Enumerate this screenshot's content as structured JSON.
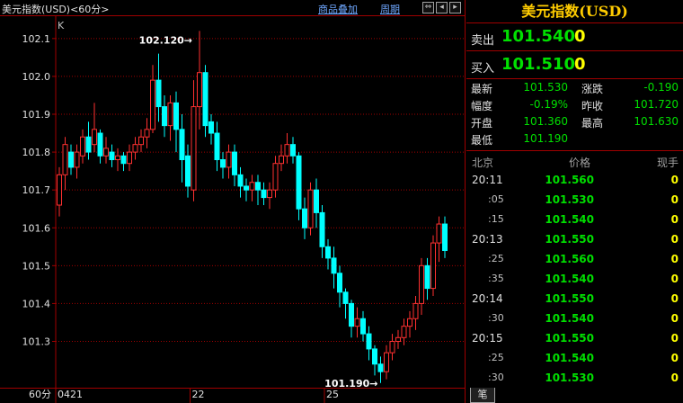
{
  "header": {
    "title": "美元指数(USD)<60分>",
    "overlay_link": "商品叠加",
    "period_link": "周期",
    "icons": [
      "arrows-icon",
      "back-icon",
      "forward-icon",
      "close-icon"
    ]
  },
  "chart_data": {
    "type": "candlestick",
    "corner_label": "K",
    "y_ticks": [
      "102.1",
      "102.0",
      "101.9",
      "101.8",
      "101.7",
      "101.6",
      "101.5",
      "101.4",
      "101.3"
    ],
    "ylim": [
      101.18,
      102.14
    ],
    "x_labels": [
      {
        "index": 0,
        "label": "0421"
      },
      {
        "index": 23,
        "label": "22"
      },
      {
        "index": 46,
        "label": "25"
      }
    ],
    "footer_period": "60分",
    "annotations": {
      "high_label": "102.120",
      "low_label": "101.190"
    },
    "candles": [
      [
        101.66,
        101.74,
        101.63,
        101.76
      ],
      [
        101.74,
        101.82,
        101.7,
        101.84
      ],
      [
        101.8,
        101.76,
        101.74,
        101.82
      ],
      [
        101.76,
        101.8,
        101.73,
        101.82
      ],
      [
        101.79,
        101.84,
        101.77,
        101.86
      ],
      [
        101.84,
        101.8,
        101.78,
        101.88
      ],
      [
        101.82,
        101.86,
        101.8,
        101.93
      ],
      [
        101.85,
        101.79,
        101.77,
        101.86
      ],
      [
        101.79,
        101.81,
        101.77,
        101.84
      ],
      [
        101.8,
        101.78,
        101.76,
        101.82
      ],
      [
        101.78,
        101.79,
        101.75,
        101.81
      ],
      [
        101.79,
        101.77,
        101.75,
        101.8
      ],
      [
        101.77,
        101.8,
        101.75,
        101.82
      ],
      [
        101.8,
        101.82,
        101.78,
        101.84
      ],
      [
        101.82,
        101.84,
        101.8,
        101.86
      ],
      [
        101.84,
        101.86,
        101.81,
        101.89
      ],
      [
        101.86,
        101.99,
        101.85,
        102.03
      ],
      [
        101.99,
        101.92,
        101.88,
        102.06
      ],
      [
        101.92,
        101.87,
        101.84,
        101.95
      ],
      [
        101.87,
        101.93,
        101.83,
        101.95
      ],
      [
        101.93,
        101.86,
        101.8,
        101.96
      ],
      [
        101.86,
        101.78,
        101.72,
        101.9
      ],
      [
        101.79,
        101.71,
        101.68,
        101.82
      ],
      [
        101.7,
        101.92,
        101.67,
        101.99
      ],
      [
        101.92,
        102.01,
        101.86,
        102.12
      ],
      [
        102.01,
        101.87,
        101.84,
        102.03
      ],
      [
        101.88,
        101.85,
        101.82,
        101.9
      ],
      [
        101.85,
        101.78,
        101.75,
        101.88
      ],
      [
        101.78,
        101.76,
        101.73,
        101.8
      ],
      [
        101.76,
        101.8,
        101.73,
        101.82
      ],
      [
        101.8,
        101.74,
        101.71,
        101.82
      ],
      [
        101.74,
        101.71,
        101.68,
        101.76
      ],
      [
        101.71,
        101.7,
        101.67,
        101.73
      ],
      [
        101.7,
        101.72,
        101.67,
        101.74
      ],
      [
        101.72,
        101.7,
        101.66,
        101.74
      ],
      [
        101.7,
        101.68,
        101.66,
        101.72
      ],
      [
        101.68,
        101.7,
        101.65,
        101.72
      ],
      [
        101.7,
        101.77,
        101.68,
        101.79
      ],
      [
        101.77,
        101.79,
        101.75,
        101.82
      ],
      [
        101.79,
        101.82,
        101.77,
        101.85
      ],
      [
        101.82,
        101.79,
        101.77,
        101.84
      ],
      [
        101.79,
        101.65,
        101.62,
        101.8
      ],
      [
        101.65,
        101.6,
        101.57,
        101.68
      ],
      [
        101.6,
        101.7,
        101.58,
        101.72
      ],
      [
        101.7,
        101.64,
        101.6,
        101.73
      ],
      [
        101.64,
        101.55,
        101.52,
        101.66
      ],
      [
        101.55,
        101.52,
        101.49,
        101.57
      ],
      [
        101.52,
        101.48,
        101.44,
        101.55
      ],
      [
        101.48,
        101.43,
        101.39,
        101.5
      ],
      [
        101.43,
        101.4,
        101.36,
        101.44
      ],
      [
        101.4,
        101.34,
        101.31,
        101.41
      ],
      [
        101.34,
        101.36,
        101.31,
        101.39
      ],
      [
        101.36,
        101.32,
        101.3,
        101.38
      ],
      [
        101.32,
        101.28,
        101.25,
        101.34
      ],
      [
        101.28,
        101.24,
        101.21,
        101.29
      ],
      [
        101.24,
        101.22,
        101.19,
        101.26
      ],
      [
        101.22,
        101.27,
        101.2,
        101.29
      ],
      [
        101.27,
        101.3,
        101.25,
        101.32
      ],
      [
        101.3,
        101.31,
        101.28,
        101.33
      ],
      [
        101.31,
        101.34,
        101.29,
        101.36
      ],
      [
        101.34,
        101.36,
        101.31,
        101.38
      ],
      [
        101.36,
        101.4,
        101.33,
        101.42
      ],
      [
        101.4,
        101.5,
        101.37,
        101.52
      ],
      [
        101.5,
        101.44,
        101.41,
        101.52
      ],
      [
        101.44,
        101.56,
        101.42,
        101.58
      ],
      [
        101.56,
        101.61,
        101.51,
        101.63
      ],
      [
        101.61,
        101.54,
        101.52,
        101.63
      ]
    ]
  },
  "quote": {
    "title": "美元指数(USD)",
    "sell": {
      "label": "卖出",
      "price": "101.540",
      "volume": "0"
    },
    "buy": {
      "label": "买入",
      "price": "101.510",
      "volume": "0"
    },
    "stats": [
      {
        "k1": "最新",
        "v1": "101.530",
        "k2": "涨跌",
        "v2": "-0.190"
      },
      {
        "k1": "幅度",
        "v1": "-0.19%",
        "k2": "昨收",
        "v2": "101.720"
      },
      {
        "k1": "开盘",
        "v1": "101.360",
        "k2": "最高",
        "v2": "101.630"
      },
      {
        "k1": "最低",
        "v1": "101.190",
        "k2": "",
        "v2": ""
      }
    ],
    "ticks_header": {
      "time": "北京",
      "price": "价格",
      "volume": "现手"
    },
    "ticks": [
      {
        "time": "20:11",
        "price": "101.560",
        "volume": "0"
      },
      {
        "time": ":05",
        "price": "101.530",
        "volume": "0"
      },
      {
        "time": ":15",
        "price": "101.540",
        "volume": "0"
      },
      {
        "time": "20:13",
        "price": "101.550",
        "volume": "0"
      },
      {
        "time": ":25",
        "price": "101.560",
        "volume": "0"
      },
      {
        "time": ":35",
        "price": "101.540",
        "volume": "0"
      },
      {
        "time": "20:14",
        "price": "101.550",
        "volume": "0"
      },
      {
        "time": ":30",
        "price": "101.540",
        "volume": "0"
      },
      {
        "time": "20:15",
        "price": "101.550",
        "volume": "0"
      },
      {
        "time": ":25",
        "price": "101.540",
        "volume": "0"
      },
      {
        "time": ":30",
        "price": "101.530",
        "volume": "0"
      }
    ],
    "bottom_tab": "笔"
  }
}
